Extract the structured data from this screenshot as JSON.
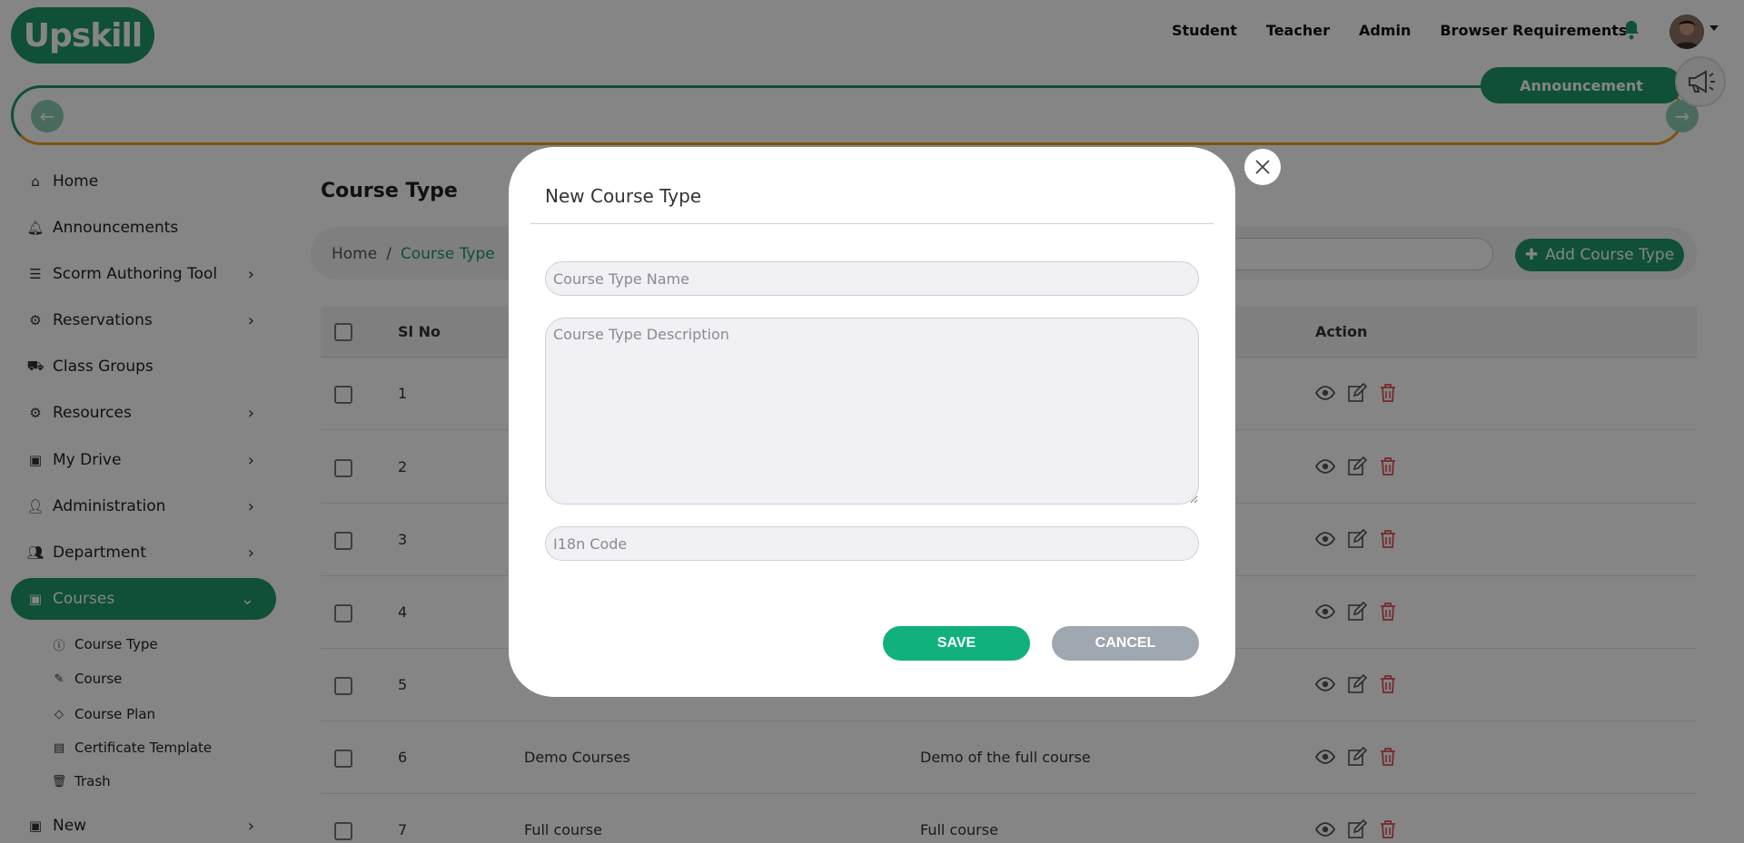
{
  "brand": {
    "logo_text": "Upskill"
  },
  "topnav": {
    "items": [
      "Student",
      "Teacher",
      "Admin",
      "Browser Requirements"
    ]
  },
  "announcement": {
    "button_label": "Announcement"
  },
  "sidebar": {
    "items": [
      {
        "label": "Home",
        "icon": "home-icon"
      },
      {
        "label": "Announcements",
        "icon": "bell-icon"
      },
      {
        "label": "Scorm Authoring Tool",
        "icon": "list-icon"
      },
      {
        "label": "Reservations",
        "icon": "gear-icon"
      },
      {
        "label": "Class Groups",
        "icon": "group-icon"
      },
      {
        "label": "Resources",
        "icon": "gear-icon"
      },
      {
        "label": "My Drive",
        "icon": "drive-icon"
      },
      {
        "label": "Administration",
        "icon": "user-gear-icon"
      },
      {
        "label": "Department",
        "icon": "users-icon"
      },
      {
        "label": "Courses",
        "icon": "book-icon"
      },
      {
        "label": "New",
        "icon": "book-icon"
      }
    ],
    "subitems": [
      {
        "label": "Course Type",
        "icon": "info-icon"
      },
      {
        "label": "Course",
        "icon": "pencil-icon"
      },
      {
        "label": "Course Plan",
        "icon": "tag-icon"
      },
      {
        "label": "Certificate Template",
        "icon": "certificate-icon"
      },
      {
        "label": "Trash",
        "icon": "trash-icon"
      }
    ]
  },
  "page": {
    "title": "Course Type",
    "breadcrumb": {
      "home": "Home",
      "separator": "/",
      "current": "Course Type"
    },
    "add_button": "Add Course Type"
  },
  "table": {
    "headers": {
      "sl_no": "Sl No",
      "action": "Action"
    },
    "rows": [
      {
        "sl": "1",
        "name": "",
        "desc": ""
      },
      {
        "sl": "2",
        "name": "",
        "desc": ""
      },
      {
        "sl": "3",
        "name": "",
        "desc": ""
      },
      {
        "sl": "4",
        "name": "",
        "desc": ""
      },
      {
        "sl": "5",
        "name": "",
        "desc": ""
      },
      {
        "sl": "6",
        "name": "Demo Courses",
        "desc": "Demo of the full course"
      },
      {
        "sl": "7",
        "name": "Full course",
        "desc": "Full course"
      }
    ]
  },
  "modal": {
    "title": "New Course Type",
    "name_placeholder": "Course Type Name",
    "desc_placeholder": "Course Type Description",
    "code_placeholder": "I18n Code",
    "save_label": "SAVE",
    "cancel_label": "CANCEL"
  },
  "colors": {
    "brand_green": "#1e9a6a",
    "save_green": "#12b07e",
    "cancel_gray": "#9fa7b0",
    "delete_red": "#e05050",
    "accent_orange": "#f0a020"
  }
}
